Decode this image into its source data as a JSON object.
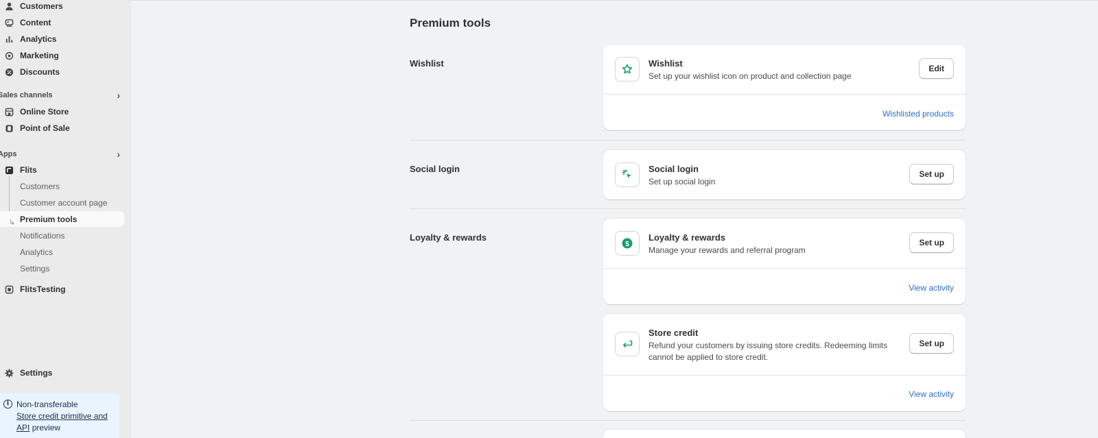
{
  "sidebar": {
    "nav": [
      {
        "label": "Customers",
        "icon": "person-icon"
      },
      {
        "label": "Content",
        "icon": "content-icon"
      },
      {
        "label": "Analytics",
        "icon": "bar-chart-icon"
      },
      {
        "label": "Marketing",
        "icon": "target-icon"
      },
      {
        "label": "Discounts",
        "icon": "discount-icon"
      }
    ],
    "sales_channels": {
      "heading": "Sales channels",
      "items": [
        {
          "label": "Online Store",
          "icon": "store-icon"
        },
        {
          "label": "Point of Sale",
          "icon": "pos-icon"
        }
      ]
    },
    "apps": {
      "heading": "Apps",
      "app": {
        "label": "Flits",
        "icon": "flits-icon"
      },
      "sub_items": [
        "Customers",
        "Customer account page",
        "Premium tools",
        "Notifications",
        "Analytics",
        "Settings"
      ],
      "other_app": {
        "label": "FlitsTesting",
        "icon": "app-icon"
      }
    },
    "settings_label": "Settings",
    "banner": {
      "prefix": "Non-transferable",
      "link": "Store credit primitive and API",
      "suffix": "preview"
    }
  },
  "main": {
    "title": "Premium tools",
    "sections": [
      {
        "name": "Wishlist",
        "cards": [
          {
            "title": "Wishlist",
            "description": "Set up your wishlist icon on product and collection page",
            "button": "Edit",
            "link": "Wishlisted products",
            "icon": "star-icon"
          }
        ]
      },
      {
        "name": "Social login",
        "cards": [
          {
            "title": "Social login",
            "description": "Set up social login",
            "button": "Set up",
            "icon": "cursor-click-icon"
          }
        ]
      },
      {
        "name": "Loyalty & rewards",
        "cards": [
          {
            "title": "Loyalty & rewards",
            "description": "Manage your rewards and referral program",
            "button": "Set up",
            "link": "View activity",
            "icon": "dollar-coin-icon"
          },
          {
            "title": "Store credit",
            "description": "Refund your customers by issuing store credits. Redeeming limits cannot be applied to store credit.",
            "button": "Set up",
            "link": "View activity",
            "icon": "return-arrow-icon"
          }
        ]
      }
    ]
  },
  "colors": {
    "accent_green": "#1a9d6f",
    "link_blue": "#2c6ecb",
    "banner_bg": "#eaf4ff"
  }
}
